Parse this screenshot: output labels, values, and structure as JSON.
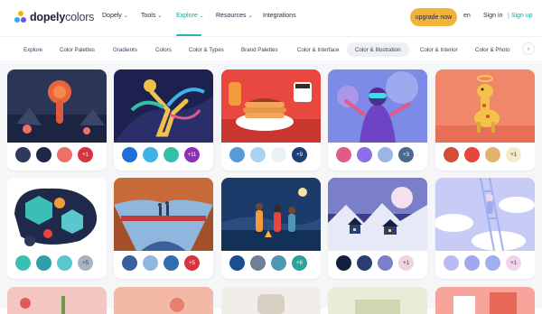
{
  "brand": {
    "name_bold": "dopely",
    "name_light": "colors"
  },
  "nav": {
    "items": [
      {
        "label": "Dopely",
        "caret": true,
        "active": false
      },
      {
        "label": "Tools",
        "caret": true,
        "active": false
      },
      {
        "label": "Explore",
        "caret": true,
        "active": true
      },
      {
        "label": "Resources",
        "caret": true,
        "active": false
      },
      {
        "label": "Integrations",
        "caret": false,
        "active": false
      }
    ],
    "upgrade_label": "upgrade now",
    "language": "en",
    "sign_in": "Sign in",
    "sign_up": "Sign up",
    "separator": "|"
  },
  "tabs": [
    {
      "label": "Explore",
      "active": false
    },
    {
      "label": "Color Palettes",
      "active": false
    },
    {
      "label": "Gradients",
      "active": false
    },
    {
      "label": "Colors",
      "active": false
    },
    {
      "label": "Color & Types",
      "active": false
    },
    {
      "label": "Brand Palettes",
      "active": false
    },
    {
      "label": "Color & Interface",
      "active": false
    },
    {
      "label": "Color & Illustration",
      "active": true
    },
    {
      "label": "Color & Interior",
      "active": false
    },
    {
      "label": "Color & Photo",
      "active": false
    }
  ],
  "tabs_next_icon": "chevron-right-icon",
  "colors": {
    "accent": "#2bb7a8",
    "upgrade": "#f2b33a",
    "background": "#f5f6f8"
  },
  "cards": [
    {
      "name": "volcano-creature",
      "swatches": [
        "#2e3a5c",
        "#1c2a48",
        "#ef6f6a"
      ],
      "badge": "+1",
      "badge_color": "#d9333f",
      "badge_light": false
    },
    {
      "name": "dancing-woman",
      "swatches": [
        "#1e6fd9",
        "#3fb2e8",
        "#34bfa8"
      ],
      "badge": "+11",
      "badge_color": "#8e2fb5",
      "badge_light": false
    },
    {
      "name": "pancakes-breakfast",
      "swatches": [
        "#5a9ad6",
        "#a9d3ef",
        "#e9f3f7"
      ],
      "badge": "+9",
      "badge_color": "#1d3f7a",
      "badge_light": false
    },
    {
      "name": "vr-woman",
      "swatches": [
        "#e05a8a",
        "#8c6fe6",
        "#9db5e6"
      ],
      "badge": "+3",
      "badge_color": "#4a6a8e",
      "badge_light": false
    },
    {
      "name": "giraffe-toy",
      "swatches": [
        "#d14f35",
        "#e8453c",
        "#e4b36e"
      ],
      "badge": "+1",
      "badge_color": "#f4ecc9",
      "badge_light": true
    },
    {
      "name": "blue-blobs",
      "swatches": [
        "#3bbfb5",
        "#2e9ea8",
        "#5cc6cf"
      ],
      "badge": "+5",
      "badge_color": "#a5b5c6",
      "badge_light": true
    },
    {
      "name": "bridge-hikers",
      "swatches": [
        "#3a5f9e",
        "#8fb6dc",
        "#2f6fb0"
      ],
      "badge": "+5",
      "badge_color": "#d9333f",
      "badge_light": false
    },
    {
      "name": "night-camp-music",
      "swatches": [
        "#1c4e8f",
        "#6e7f96",
        "#4d97b5"
      ],
      "badge": "+6",
      "badge_color": "#2ba39a",
      "badge_light": false
    },
    {
      "name": "winter-village",
      "swatches": [
        "#10203d",
        "#2b3d73",
        "#7b7fc9"
      ],
      "badge": "+1",
      "badge_color": "#efd1df",
      "badge_light": true
    },
    {
      "name": "ladder-clouds",
      "swatches": [
        "#b8bcf2",
        "#a3a8ee",
        "#9eb0f0"
      ],
      "badge": "+1",
      "badge_color": "#f4d3ec",
      "badge_light": true
    }
  ]
}
